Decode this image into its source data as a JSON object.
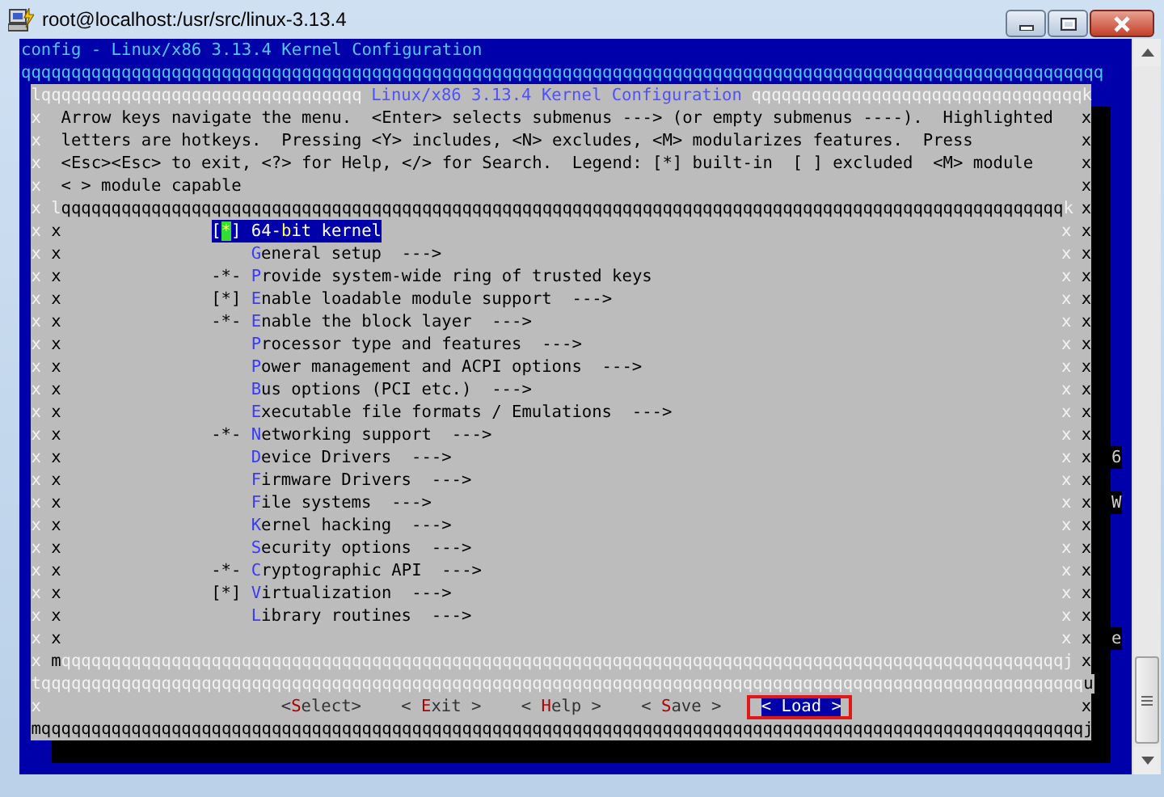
{
  "window": {
    "title": "root@localhost:/usr/src/linux-3.13.4"
  },
  "terminal": {
    "header": "config - Linux/x86 3.13.4 Kernel Configuration",
    "header_rule": "qqqqqqqqqqqqqqqqqqqqqqqqqqqqqqqqqqqqqqqqqqqqqqqqqqqqqqqqqqqqqqqqqqqqqqqqqqqqqqqqqqqqqqqqqqqqqqqqqqqqqqqqqqqq",
    "dialog": {
      "top_left": "lqqqqqqqqqqqqqqqqqqqqqqqqqqqqqqqq",
      "title": "Linux/x86 3.13.4 Kernel Configuration",
      "top_right": "qqqqqqqqqqqqqqqqqqqqqqqqqqqqqqqqqk",
      "help_lines": [
        {
          "edges": [
            "x",
            "x"
          ],
          "text": "Arrow keys navigate the menu.  <Enter> selects submenus ---> (or empty submenus ----).  Highlighted"
        },
        {
          "edges": [
            "x",
            "x"
          ],
          "text": "letters are hotkeys.  Pressing <Y> includes, <N> excludes, <M> modularizes features.  Press"
        },
        {
          "edges": [
            "x",
            "x"
          ],
          "text": "<Esc><Esc> to exit, <?> for Help, </> for Search.  Legend: [*] built-in  [ ] excluded  <M> module"
        },
        {
          "edges": [
            "x",
            "x"
          ],
          "text": "< > module capable"
        }
      ],
      "menu_top": {
        "edges": [
          "x",
          "x"
        ],
        "rule": "lqqqqqqqqqqqqqqqqqqqqqqqqqqqqqqqqqqqqqqqqqqqqqqqqqqqqqqqqqqqqqqqqqqqqqqqqqqqqqqqqqqqqqqqqqqqqqqqqqqqqk"
      },
      "menu_rows": [
        {
          "kind": "item",
          "edges": [
            "x",
            "x",
            "x",
            "x"
          ],
          "prefix": "[*]",
          "before": "64-",
          "hotkey": "b",
          "after": "it kernel",
          "selected": true
        },
        {
          "kind": "item",
          "edges": [
            "x",
            "x",
            "x",
            "x"
          ],
          "hotkey": "G",
          "after": "eneral setup",
          "arrow": "--->",
          "selected": false
        },
        {
          "kind": "item",
          "edges": [
            "x",
            "x",
            "x",
            "x"
          ],
          "prefix": "-*-",
          "hotkey": "P",
          "after": "rovide system-wide ring of trusted keys",
          "selected": false
        },
        {
          "kind": "item",
          "edges": [
            "x",
            "x",
            "x",
            "x"
          ],
          "prefix": "[*]",
          "hotkey": "E",
          "after": "nable loadable module support",
          "arrow": "--->",
          "selected": false
        },
        {
          "kind": "item",
          "edges": [
            "x",
            "x",
            "x",
            "x"
          ],
          "prefix": "-*-",
          "hotkey": "E",
          "after": "nable the block layer",
          "arrow": "--->",
          "selected": false
        },
        {
          "kind": "item",
          "edges": [
            "x",
            "x",
            "x",
            "x"
          ],
          "hotkey": "P",
          "after": "rocessor type and features",
          "arrow": "--->",
          "selected": false
        },
        {
          "kind": "item",
          "edges": [
            "x",
            "x",
            "x",
            "x"
          ],
          "hotkey": "P",
          "after": "ower management and ACPI options",
          "arrow": "--->",
          "selected": false
        },
        {
          "kind": "item",
          "edges": [
            "x",
            "x",
            "x",
            "x"
          ],
          "hotkey": "B",
          "after": "us options (PCI etc.)",
          "arrow": "--->",
          "selected": false
        },
        {
          "kind": "item",
          "edges": [
            "x",
            "x",
            "x",
            "x"
          ],
          "hotkey": "E",
          "after": "xecutable file formats / Emulations",
          "arrow": "--->",
          "selected": false
        },
        {
          "kind": "item",
          "edges": [
            "x",
            "x",
            "x",
            "x"
          ],
          "prefix": "-*-",
          "hotkey": "N",
          "after": "etworking support",
          "arrow": "--->",
          "selected": false
        },
        {
          "kind": "item",
          "edges": [
            "x",
            "x",
            "x",
            "x"
          ],
          "hotkey": "D",
          "after": "evice Drivers",
          "arrow": "--->",
          "selected": false,
          "behind": "6"
        },
        {
          "kind": "item",
          "edges": [
            "x",
            "x",
            "x",
            "x"
          ],
          "hotkey": "F",
          "after": "irmware Drivers",
          "arrow": "--->",
          "selected": false
        },
        {
          "kind": "item",
          "edges": [
            "x",
            "x",
            "x",
            "x"
          ],
          "hotkey": "F",
          "after": "ile systems",
          "arrow": "--->",
          "selected": false,
          "behind": "W"
        },
        {
          "kind": "item",
          "edges": [
            "x",
            "x",
            "x",
            "x"
          ],
          "hotkey": "K",
          "after": "ernel hacking",
          "arrow": "--->",
          "selected": false
        },
        {
          "kind": "item",
          "edges": [
            "x",
            "x",
            "x",
            "x"
          ],
          "hotkey": "S",
          "after": "ecurity options",
          "arrow": "--->",
          "selected": false
        },
        {
          "kind": "item",
          "edges": [
            "x",
            "x",
            "x",
            "x"
          ],
          "prefix": "-*-",
          "hotkey": "C",
          "after": "ryptographic API",
          "arrow": "--->",
          "selected": false
        },
        {
          "kind": "item",
          "edges": [
            "x",
            "x",
            "x",
            "x"
          ],
          "prefix": "[*]",
          "hotkey": "V",
          "after": "irtualization",
          "arrow": "--->",
          "selected": false
        },
        {
          "kind": "item",
          "edges": [
            "x",
            "x",
            "x",
            "x"
          ],
          "hotkey": "L",
          "after": "ibrary routines",
          "arrow": "--->",
          "selected": false
        },
        {
          "kind": "blank",
          "edges": [
            "x",
            "x",
            "x",
            "x"
          ],
          "behind": "e"
        }
      ],
      "menu_bottom": {
        "edges": [
          "x",
          "x"
        ],
        "rule": "mqqqqqqqqqqqqqqqqqqqqqqqqqqqqqqqqqqqqqqqqqqqqqqqqqqqqqqqqqqqqqqqqqqqqqqqqqqqqqqqqqqqqqqqqqqqqqqqqqqqqj"
      },
      "separator": "tqqqqqqqqqqqqqqqqqqqqqqqqqqqqqqqqqqqqqqqqqqqqqqqqqqqqqqqqqqqqqqqqqqqqqqqqqqqqqqqqqqqqqqqqqqqqqqqqqqqqqqqqu",
      "button_row_edges": [
        "x",
        "x"
      ],
      "buttons": [
        {
          "before": "<",
          "hotkey": "S",
          "after": "elect>",
          "selected": false,
          "annotated": false
        },
        {
          "before": "< ",
          "hotkey": "E",
          "after": "xit >",
          "selected": false,
          "annotated": false
        },
        {
          "before": "< ",
          "hotkey": "H",
          "after": "elp >",
          "selected": false,
          "annotated": false
        },
        {
          "before": "< ",
          "hotkey": "S",
          "after": "ave >",
          "selected": false,
          "annotated": false
        },
        {
          "before": "< ",
          "hotkey": "L",
          "after": "oad >",
          "selected": true,
          "annotated": true
        }
      ],
      "bottom": "mqqqqqqqqqqqqqqqqqqqqqqqqqqqqqqqqqqqqqqqqqqqqqqqqqqqqqqqqqqqqqqqqqqqqqqqqqqqqqqqqqqqqqqqqqqqqqqqqqqqqqqqqj"
    }
  }
}
